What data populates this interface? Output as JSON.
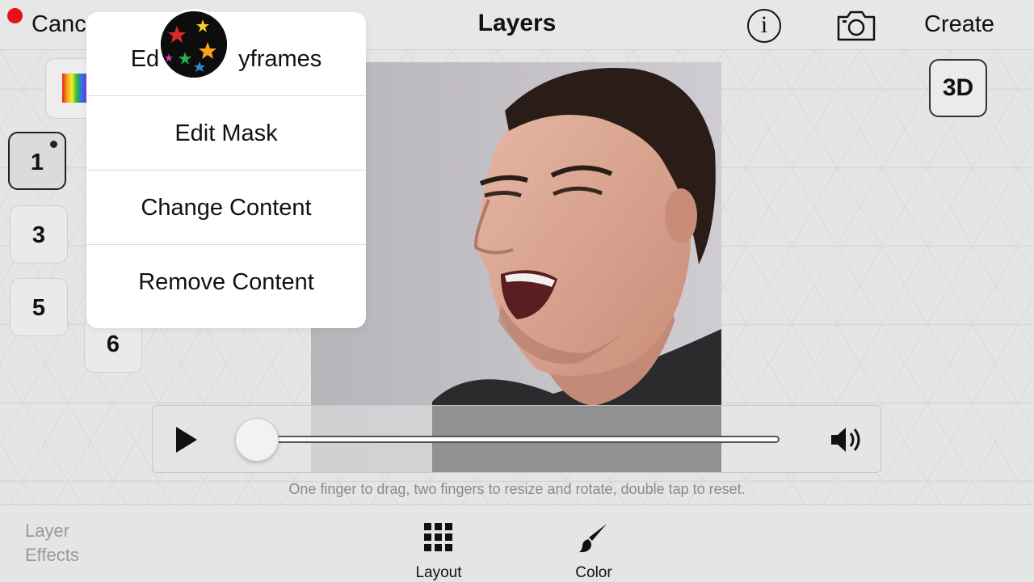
{
  "topbar": {
    "cancel_label": "Canc",
    "title": "Layers",
    "info_glyph": "i",
    "create_label": "Create"
  },
  "layers": {
    "items": [
      "1",
      "3",
      "5",
      "6"
    ],
    "selected": "1"
  },
  "view_toggle": {
    "label": "3D"
  },
  "menu": {
    "items": [
      "Edit Keyframes",
      "Edit Mask",
      "Change Content",
      "Remove Content"
    ],
    "visible_first_item": [
      "Ed",
      "yframes"
    ]
  },
  "player": {
    "progress": 0,
    "icons": [
      "play-icon",
      "volume-icon"
    ]
  },
  "hint": "One finger to drag, two fingers to resize and rotate, double tap to reset.",
  "bottom": {
    "layer_effects": [
      "Layer",
      "Effects"
    ],
    "tools": [
      {
        "label": "Layout",
        "icon": "grid-icon"
      },
      {
        "label": "Color",
        "icon": "brush-icon"
      }
    ]
  },
  "colors": {
    "record": "#e8101a",
    "background": "#e6e5e6",
    "menu_bg": "#ffffff",
    "text": "#111111",
    "hint": "#8a8a8a"
  }
}
